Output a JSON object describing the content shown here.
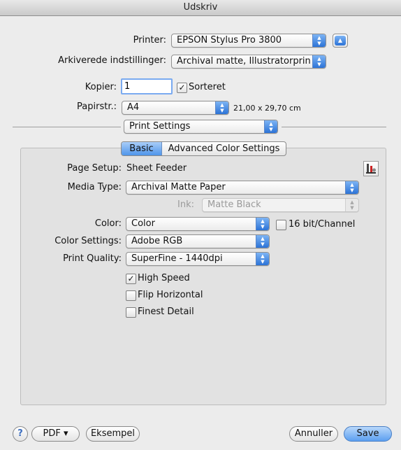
{
  "window": {
    "title": "Udskriv"
  },
  "printer": {
    "label": "Printer:",
    "value": "EPSON Stylus Pro 3800"
  },
  "presets": {
    "label": "Arkiverede indstillinger:",
    "value": "Archival matte, Illustratorprints"
  },
  "copies": {
    "label": "Kopier:",
    "value": "1",
    "collate_label": "Sorteret",
    "collate_checked": true
  },
  "paper": {
    "label": "Papirstr.:",
    "value": "A4",
    "size_text": "21,00 x 29,70 cm"
  },
  "pane": {
    "value": "Print Settings"
  },
  "tabs": [
    {
      "label": "Basic",
      "selected": true
    },
    {
      "label": "Advanced Color Settings",
      "selected": false
    }
  ],
  "settings": {
    "page_setup_label": "Page Setup:",
    "page_setup_value": "Sheet Feeder",
    "media_type_label": "Media Type:",
    "media_type_value": "Archival Matte Paper",
    "ink_label": "Ink:",
    "ink_value": "Matte Black",
    "color_label": "Color:",
    "color_value": "Color",
    "bit16_label": "16 bit/Channel",
    "bit16_checked": false,
    "color_settings_label": "Color Settings:",
    "color_settings_value": "Adobe RGB",
    "print_quality_label": "Print Quality:",
    "print_quality_value": "SuperFine - 1440dpi",
    "high_speed_label": "High Speed",
    "high_speed_checked": true,
    "flip_label": "Flip Horizontal",
    "flip_checked": false,
    "finest_label": "Finest Detail",
    "finest_checked": false
  },
  "footer": {
    "help": "?",
    "pdf": "PDF ▾",
    "preview": "Eksempel",
    "cancel": "Annuller",
    "save": "Save"
  },
  "icons": {
    "updown": "updown-arrows-icon",
    "disclosure": "disclosure-up-icon",
    "utility": "printer-utility-icon"
  },
  "colors": {
    "accent": "#3b83e0",
    "panel": "#e2e2e2",
    "window": "#ececec"
  }
}
